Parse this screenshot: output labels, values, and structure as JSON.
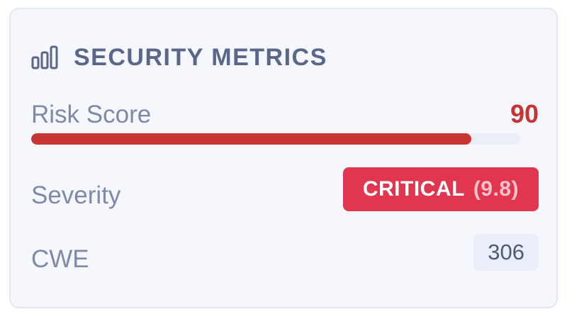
{
  "header": {
    "title": "SECURITY METRICS",
    "icon": "bar-chart-icon"
  },
  "risk": {
    "label": "Risk Score",
    "value": "90",
    "progress_percent": 90,
    "color": "#c53333"
  },
  "severity": {
    "label": "Severity",
    "level": "CRITICAL",
    "score": "(9.8)",
    "badge_color": "#e23650"
  },
  "cwe": {
    "label": "CWE",
    "value": "306"
  }
}
